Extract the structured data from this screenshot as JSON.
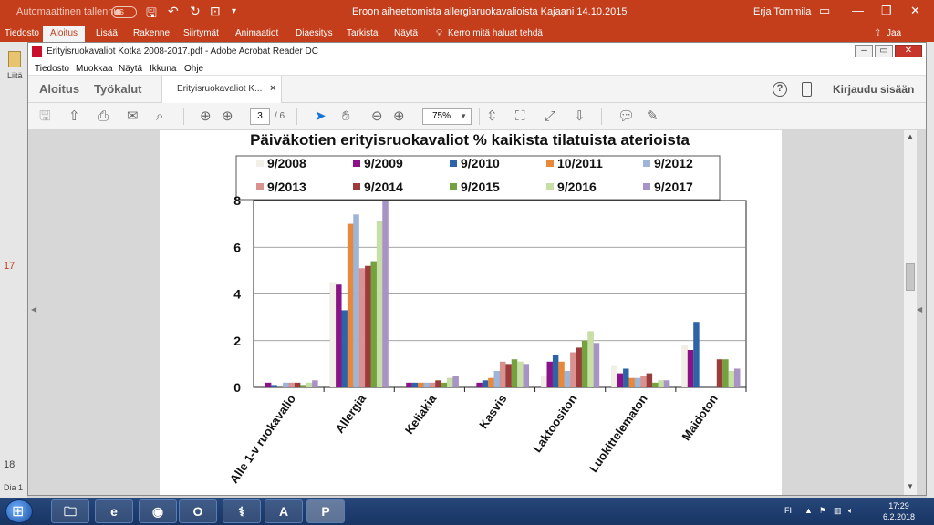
{
  "ppt": {
    "autosave": "Automaattinen tallennus",
    "title": "Eroon aiheettomista  allergiaruokavalioista Kajaani 14.10.2015",
    "user": "Erja Tommila",
    "share": "Jaa",
    "tabs": [
      "Tiedosto",
      "Aloitus",
      "Lisää",
      "Rakenne",
      "Siirtymät",
      "Animaatiot",
      "Diaesitys",
      "Tarkista",
      "Näytä"
    ],
    "tell_me": "Kerro mitä haluat tehdä",
    "left_liita": "Liitä",
    "slide_17": "17",
    "slide_18": "18",
    "dia": "Dia 1"
  },
  "acrobat": {
    "window_title": "Erityisruokavaliot Kotka 2008-2017.pdf - Adobe Acrobat Reader DC",
    "menu": [
      "Tiedosto",
      "Muokkaa",
      "Näytä",
      "Ikkuna",
      "Ohje"
    ],
    "tab_home": "Aloitus",
    "tab_tools": "Työkalut",
    "doc_tab": "Erityisruokavaliot K...",
    "help": "?",
    "signin": "Kirjaudu sisään",
    "page_current": "3",
    "page_count": "/ 6",
    "zoom": "75%"
  },
  "chart_data": {
    "type": "bar",
    "title": "Päiväkotien erityisruokavaliot % kaikista tilatuista aterioista",
    "categories": [
      "Alle 1-v ruokavalio",
      "Allergia",
      "Keliakia",
      "Kasvis",
      "Laktoositon",
      "Luokittelematon",
      "Maidoton"
    ],
    "ylim": [
      0,
      8
    ],
    "yticks": [
      "0",
      "2",
      "4",
      "6",
      "8"
    ],
    "grid": true,
    "legend_position": "top",
    "series": [
      {
        "name": "9/2008",
        "color": "#f2f0e6",
        "values": [
          0.0,
          4.5,
          0.0,
          0.0,
          0.5,
          0.9,
          1.8
        ]
      },
      {
        "name": "9/2009",
        "color": "#8b1288",
        "values": [
          0.2,
          4.4,
          0.2,
          0.2,
          1.1,
          0.6,
          1.6
        ]
      },
      {
        "name": "9/2010",
        "color": "#2d64a8",
        "values": [
          0.1,
          3.3,
          0.2,
          0.3,
          1.4,
          0.8,
          2.8
        ]
      },
      {
        "name": "10/2011",
        "color": "#e8883a",
        "values": [
          0.0,
          7.0,
          0.2,
          0.4,
          1.1,
          0.4,
          0.0
        ]
      },
      {
        "name": "9/2012",
        "color": "#9db5d8",
        "values": [
          0.2,
          7.4,
          0.2,
          0.7,
          0.7,
          0.4,
          0.0
        ]
      },
      {
        "name": "9/2013",
        "color": "#d9928f",
        "values": [
          0.2,
          5.1,
          0.2,
          1.1,
          1.5,
          0.5,
          0.0
        ]
      },
      {
        "name": "9/2014",
        "color": "#9c3b3b",
        "values": [
          0.2,
          5.2,
          0.3,
          1.0,
          1.7,
          0.6,
          1.2
        ]
      },
      {
        "name": "9/2015",
        "color": "#74a23e",
        "values": [
          0.1,
          5.4,
          0.2,
          1.2,
          2.0,
          0.2,
          1.2
        ]
      },
      {
        "name": "9/2016",
        "color": "#c7dea4",
        "values": [
          0.2,
          7.1,
          0.4,
          1.1,
          2.4,
          0.3,
          0.7
        ]
      },
      {
        "name": "9/2017",
        "color": "#a893c6",
        "values": [
          0.3,
          8.0,
          0.5,
          1.0,
          1.9,
          0.3,
          0.8
        ]
      }
    ]
  },
  "taskbar": {
    "apps": [
      {
        "name": "file-explorer",
        "glyph": "🗀"
      },
      {
        "name": "internet-explorer",
        "glyph": "e"
      },
      {
        "name": "firefox",
        "glyph": "◉"
      },
      {
        "name": "outlook",
        "glyph": "O"
      },
      {
        "name": "tool-app",
        "glyph": "⚕"
      },
      {
        "name": "acrobat",
        "glyph": "A"
      },
      {
        "name": "powerpoint",
        "glyph": "P"
      }
    ],
    "lang": "FI",
    "time": "17:29",
    "date": "6.2.2018"
  },
  "colors": {
    "ppt_brand": "#c43e1c",
    "taskbar": "#1f3d6e",
    "acrobat_accent": "#1673d8"
  }
}
